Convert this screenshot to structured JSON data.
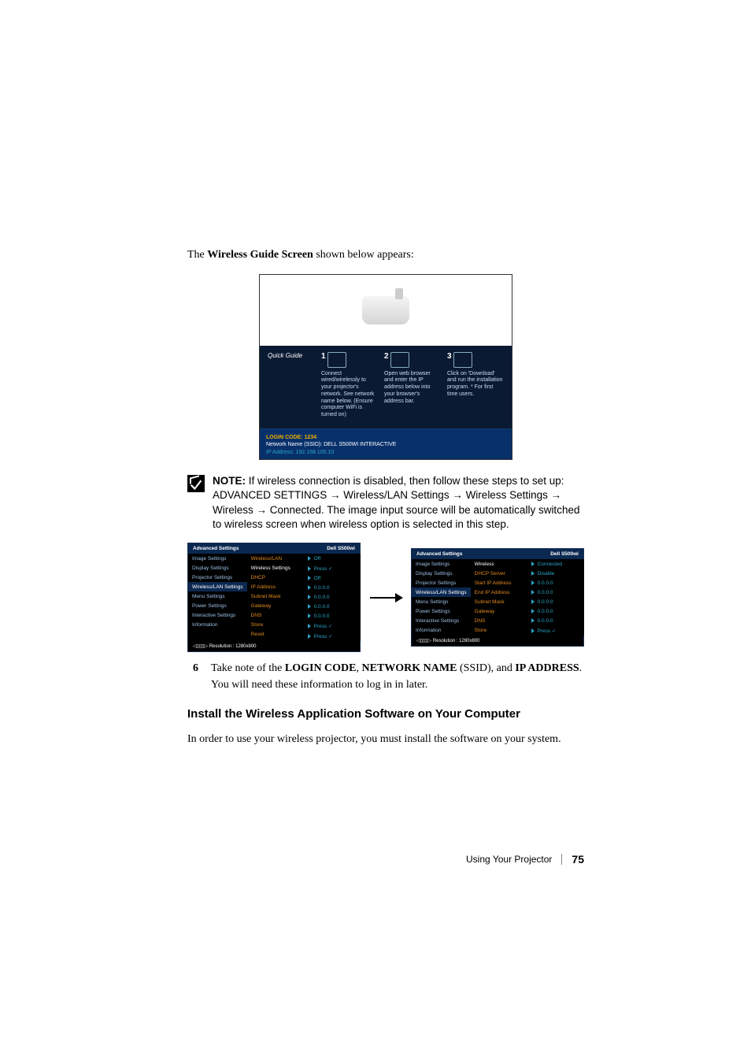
{
  "intro_sentence": {
    "before": "The ",
    "bold": "Wireless Guide Screen",
    "after": " shown below appears:"
  },
  "guide": {
    "quick_guide_label": "Quick Guide",
    "steps": [
      {
        "num": "1",
        "text": "Connect wired/wirelessly to your projector's network. See network name below. (Ensure computer WiFi is turned on)"
      },
      {
        "num": "2",
        "text": "Open web browser and enter the IP address below into your browser's address bar."
      },
      {
        "num": "3",
        "text": "Click on 'Download' and run the installation program. * For first time users."
      }
    ],
    "login_code_label": "LOGIN CODE: ",
    "login_code": "1234",
    "ssid_line": "Network Name (SSID): DELL S500WI INTERACTIVE",
    "ip_line": "IP Address: 192.168.100.10"
  },
  "note": {
    "label": "NOTE:",
    "text": " If wireless connection is disabled, then follow these steps to set up: ADVANCED SETTINGS → Wireless/LAN Settings → Wireless Settings → Wireless → Connected. The image input source will be automatically switched to wireless screen when wireless option is selected in this step."
  },
  "menu_left": {
    "title_left": "Advanced Settings",
    "title_right": "Dell  S500wi",
    "col1": [
      "Image Settings",
      "Display Settings",
      "Projector Settings",
      "Wireless/LAN Settings",
      "Menu Settings",
      "Power Settings",
      "Interactive Settings",
      "Information"
    ],
    "col1_selected_index": 3,
    "col2": [
      "Wireless/LAN",
      "Wireless Settings",
      "DHCP",
      "IP Address",
      "Subnet Mask",
      "Gateway",
      "DNS",
      "Store",
      "Reset"
    ],
    "col2_selected_index": 1,
    "col3": [
      "Off",
      "Press  ✓",
      "Off",
      "0.0.0.0",
      "0.0.0.0",
      "0.0.0.0",
      "0.0.0.0",
      "Press  ✓",
      "Press  ✓"
    ],
    "footer": "Resolution : 1280x800"
  },
  "menu_right": {
    "title_left": "Advanced Settings",
    "title_right": "Dell  S500wi",
    "col1": [
      "Image Settings",
      "Display Settings",
      "Projector Settings",
      "Wireless/LAN Settings",
      "Menu Settings",
      "Power Settings",
      "Interactive Settings",
      "Information"
    ],
    "col1_selected_index": 3,
    "col2": [
      "Wireless",
      "DHCP Server",
      "Start IP Address",
      "End IP Address",
      "Subnet Mask",
      "Gateway",
      "DNS",
      "Store"
    ],
    "col2_selected_index": 0,
    "col3": [
      "Connected",
      "Disable",
      "0.0.0.0",
      "0.0.0.0",
      "0.0.0.0",
      "0.0.0.0",
      "0.0.0.0",
      "Press  ✓"
    ],
    "footer": "Resolution : 1280x800"
  },
  "step6": {
    "num": "6",
    "text_parts": {
      "p1": "Take note of the ",
      "b1": "LOGIN CODE",
      "p2": ", ",
      "b2": "NETWORK NAME",
      "p3": " (SSID), and ",
      "b3": "IP ADDRESS",
      "p4": ". You will need these information to log in in later."
    }
  },
  "heading": "Install the Wireless Application Software on Your Computer",
  "para": "In order to use your wireless projector, you must install the software on your system.",
  "footer": {
    "section": "Using Your Projector",
    "page": "75"
  }
}
